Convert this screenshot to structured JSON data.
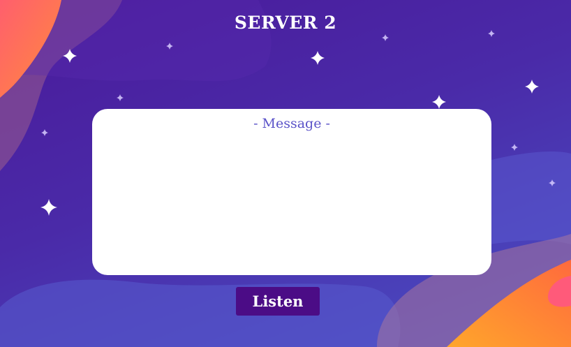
{
  "header": {
    "title": "SERVER 2"
  },
  "message_panel": {
    "heading": "- Message -",
    "content": ""
  },
  "actions": {
    "listen_label": "Listen"
  },
  "colors": {
    "background_top": "#4a1a9a",
    "background_bottom": "#4a4fc4",
    "panel": "#ffffff",
    "heading_text": "#5a52c8",
    "button": "#4b0c86",
    "accent_orange": "#ff8c2a",
    "accent_pink": "#ff5a7a"
  }
}
